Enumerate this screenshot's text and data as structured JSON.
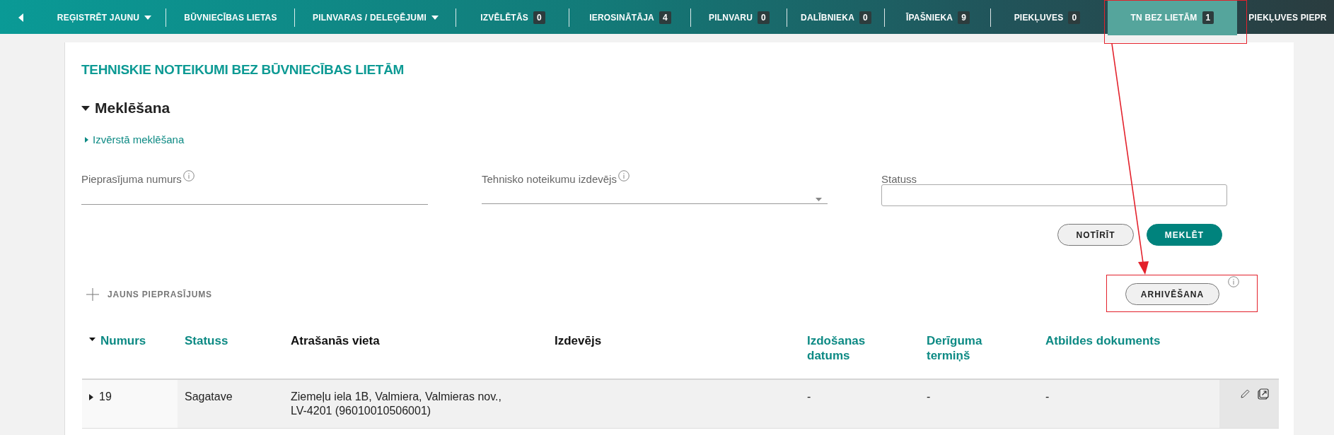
{
  "nav": {
    "items": [
      {
        "label": "REĢISTRĒT JAUNU",
        "kind": "dropdown",
        "selected": false
      },
      {
        "label": "BŪVNIECĪBAS LIETAS",
        "kind": "link",
        "selected": false
      },
      {
        "label": "PILNVARAS / DELEĢĒJUMI",
        "kind": "dropdown",
        "selected": false
      },
      {
        "label": "IZVĒLĒTĀS",
        "count": "0",
        "kind": "counter",
        "selected": false
      },
      {
        "label": "IEROSINĀTĀJA",
        "count": "4",
        "kind": "counter",
        "selected": false
      },
      {
        "label": "PILNVARU",
        "count": "0",
        "kind": "counter",
        "selected": false
      },
      {
        "label": "DALĪBNIEKA",
        "count": "0",
        "kind": "counter",
        "selected": false
      },
      {
        "label": "ĪPAŠNIEKA",
        "count": "9",
        "kind": "counter",
        "selected": false
      },
      {
        "label": "PIEKĻUVES",
        "count": "0",
        "kind": "counter",
        "selected": false
      },
      {
        "label": "TN BEZ LIETĀM",
        "count": "1",
        "kind": "counter",
        "selected": true
      },
      {
        "label": "PIEKĻUVES PIEPR",
        "kind": "link",
        "selected": false
      }
    ]
  },
  "title": "TEHNISKIE NOTEIKUMI BEZ BŪVNIECĪBAS LIETĀM",
  "search": {
    "heading": "Meklēšana",
    "expanded": true,
    "advanced_link": "Izvērstā meklēšana",
    "fields": [
      {
        "label": "Pieprasījuma numurs",
        "kind": "text",
        "info": true
      },
      {
        "label": "Tehnisko noteikumu izdevējs",
        "kind": "select",
        "info": true
      },
      {
        "label": "Statuss",
        "kind": "box",
        "info": false
      }
    ],
    "buttons": [
      {
        "label": "NOTĪRĪT",
        "kind": "secondary"
      },
      {
        "label": "MEKLĒT",
        "kind": "primary"
      }
    ]
  },
  "new_request": "JAUNS PIEPRASĪJUMS",
  "archive_button": "ARHIVĒŠANA",
  "table": {
    "columns": [
      {
        "label": "Numurs",
        "sortable": true,
        "sorted": true
      },
      {
        "label": "Statuss",
        "sortable": true,
        "sorted": false
      },
      {
        "label": "Atrašanās vieta",
        "sortable": false,
        "sorted": false
      },
      {
        "label": "Izdevējs",
        "sortable": false,
        "sorted": false
      },
      {
        "label": "Izdošanas datums",
        "sortable": true,
        "sorted": false
      },
      {
        "label": "Derīguma termiņš",
        "sortable": true,
        "sorted": false
      },
      {
        "label": "Atbildes dokuments",
        "sortable": true,
        "sorted": false
      }
    ],
    "rows": [
      {
        "expanded": false,
        "cells": [
          "19",
          "Sagatave",
          "Ziemeļu iela 1B, Valmiera, Valmieras nov., LV-4201 (96010010506001)",
          "",
          "-",
          "-",
          "-"
        ]
      }
    ]
  }
}
